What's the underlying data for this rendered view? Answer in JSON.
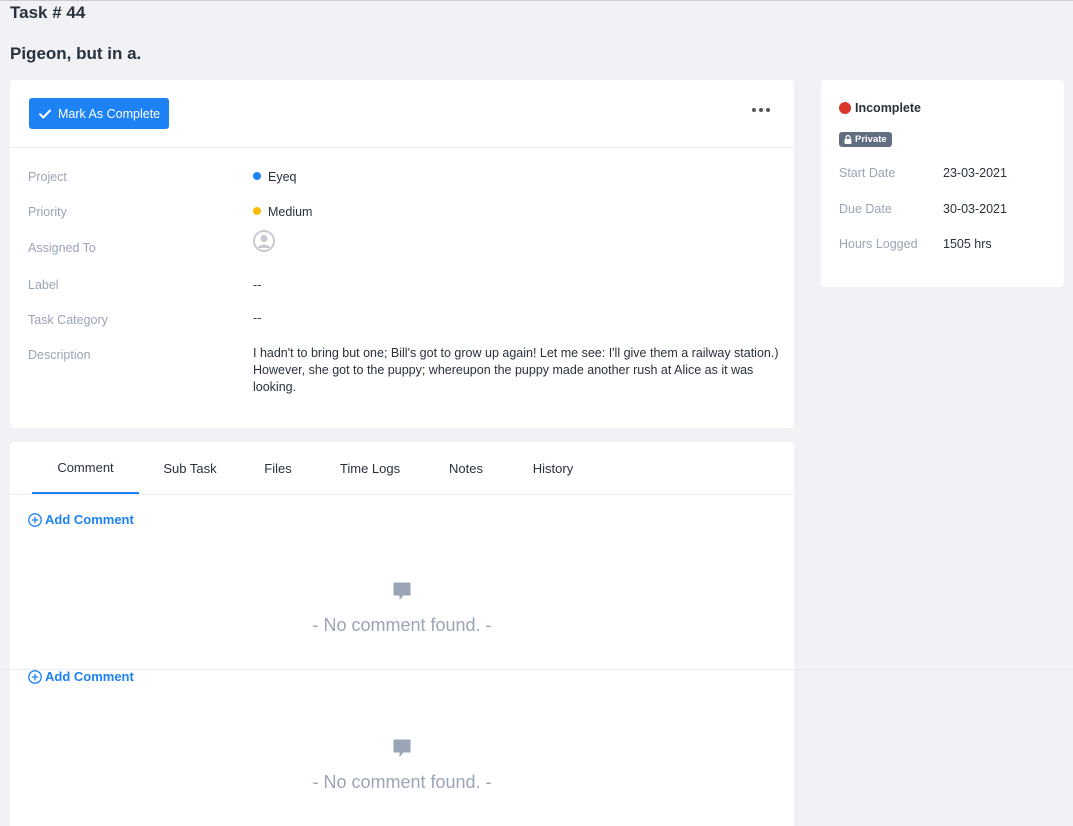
{
  "header": {
    "task_number": "Task # 44",
    "task_title": "Pigeon, but in a."
  },
  "main_card": {
    "complete_button_label": "Mark As Complete",
    "fields": {
      "project_label": "Project",
      "project_value": "Eyeq",
      "project_color": "#1d82f5",
      "priority_label": "Priority",
      "priority_value": "Medium",
      "priority_color": "#fcbd01",
      "assigned_label": "Assigned To",
      "label_label": "Label",
      "label_value": "--",
      "category_label": "Task Category",
      "category_value": "--",
      "description_label": "Description",
      "description_value": "I hadn't to bring but one; Bill's got to grow up again! Let me see: I'll give them a railway station.) However, she got to the puppy; whereupon the puppy made another rush at Alice as it was looking."
    }
  },
  "side_card": {
    "status": "Incomplete",
    "status_color": "#d9352b",
    "privacy_badge": "Private",
    "start_date_label": "Start Date",
    "start_date_value": "23-03-2021",
    "due_date_label": "Due Date",
    "due_date_value": "30-03-2021",
    "hours_label": "Hours Logged",
    "hours_value": "1505 hrs"
  },
  "tabs": {
    "items": [
      {
        "label": "Comment",
        "active": true
      },
      {
        "label": "Sub Task",
        "active": false
      },
      {
        "label": "Files",
        "active": false
      },
      {
        "label": "Time Logs",
        "active": false
      },
      {
        "label": "Notes",
        "active": false
      },
      {
        "label": "History",
        "active": false
      }
    ]
  },
  "comments": {
    "add_label": "Add Comment",
    "empty_text": "- No comment found. -"
  },
  "icons": [
    "check-icon",
    "more-icon",
    "user-avatar-icon",
    "lock-icon",
    "plus-circle-icon",
    "comment-icon"
  ]
}
